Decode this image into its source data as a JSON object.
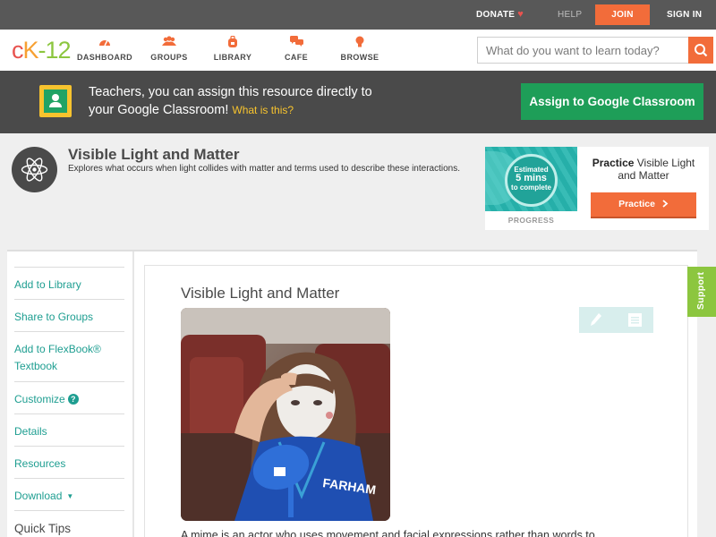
{
  "topbar": {
    "donate": "DONATE",
    "help": "HELP",
    "join": "JOIN",
    "signin": "SIGN IN"
  },
  "nav": {
    "logo": {
      "c": "c",
      "k": "K",
      "dash": "-",
      "num": "12"
    },
    "items": [
      {
        "label": "DASHBOARD",
        "icon": "gauge-icon"
      },
      {
        "label": "GROUPS",
        "icon": "people-icon"
      },
      {
        "label": "LIBRARY",
        "icon": "backpack-icon"
      },
      {
        "label": "CAFE",
        "icon": "chat-bubbles-icon"
      },
      {
        "label": "BROWSE",
        "icon": "lightbulb-icon"
      }
    ],
    "search_placeholder": "What do you want to learn today?"
  },
  "classroom": {
    "line1": "Teachers, you can assign this resource directly to",
    "line2": "your Google Classroom!",
    "whatis": "What is this?",
    "assign": "Assign to Google Classroom"
  },
  "concept": {
    "title": "Visible Light and Matter",
    "description": "Explores what occurs when light collides with matter and terms used to describe these interactions."
  },
  "practice": {
    "badge_estimated": "Estimated",
    "badge_mins": "5 mins",
    "badge_complete": "to complete",
    "progress": "PROGRESS",
    "title_bold": "Practice",
    "title_rest": "Visible Light and Matter",
    "button": "Practice"
  },
  "sidebar": {
    "items": [
      {
        "label": "Add to Library"
      },
      {
        "label": "Share to Groups"
      },
      {
        "label": "Add to FlexBook® Textbook"
      },
      {
        "label": "Customize"
      },
      {
        "label": "Details"
      },
      {
        "label": "Resources"
      },
      {
        "label": "Download"
      },
      {
        "label": "Quick Tips"
      }
    ]
  },
  "content": {
    "title": "Visible Light and Matter",
    "photo_shirt_text": "FARHAM",
    "text": "A mime is an actor who uses movement and facial expressions rather than words to"
  },
  "support": "Support",
  "colors": {
    "accent": "#f26c3a",
    "teal": "#1e9e91",
    "green": "#1e9e58",
    "support_green": "#8cc63f",
    "dark": "#4a4a4a"
  }
}
